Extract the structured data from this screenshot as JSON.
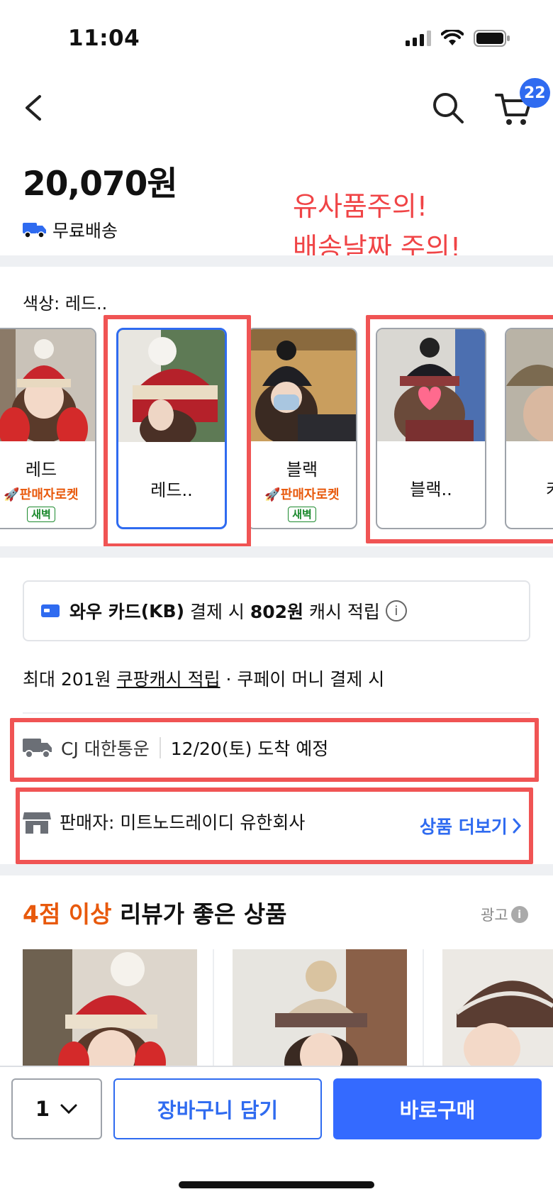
{
  "status_bar": {
    "time": "11:04"
  },
  "header": {
    "cart_count": "22"
  },
  "product": {
    "price": "20,070원",
    "shipping": "무료배송"
  },
  "annotation": {
    "line1": "유사품주의!",
    "line2": "배송날짜 주의!",
    "color": "#f04446"
  },
  "options": {
    "label": "색상: 레드..",
    "items": [
      {
        "name": "레드",
        "rocket": "판매자로켓",
        "badge": "새벽"
      },
      {
        "name": "레드..",
        "selected": true
      },
      {
        "name": "블랙",
        "rocket": "판매자로켓",
        "badge": "새벽"
      },
      {
        "name": "블랙.."
      },
      {
        "name": "카"
      }
    ]
  },
  "benefit": {
    "prefix": "와우 카드",
    "card": "(KB)",
    "mid": " 결제 시 ",
    "amount": "802원",
    "suffix": " 캐시 적립"
  },
  "cash": {
    "prefix": "최대 201원 ",
    "link": "쿠팡캐시 적립",
    "suffix": " · 쿠페이 머니 결제 시"
  },
  "delivery": {
    "carrier": "CJ 대한통운",
    "eta": "12/20(토) 도착 예정"
  },
  "seller": {
    "label": "판매자: 미트노드레이디 유한회사",
    "more": "상품 더보기"
  },
  "recommend": {
    "title_highlight": "4점 이상",
    "title_rest": " 리뷰가 좋은 상품",
    "ad": "광고"
  },
  "bottom": {
    "quantity": "1",
    "add_cart": "장바구니 담기",
    "buy_now": "바로구매"
  },
  "colors": {
    "accent": "#346aff",
    "highlight": "#e8590c",
    "alert": "#f05454"
  }
}
